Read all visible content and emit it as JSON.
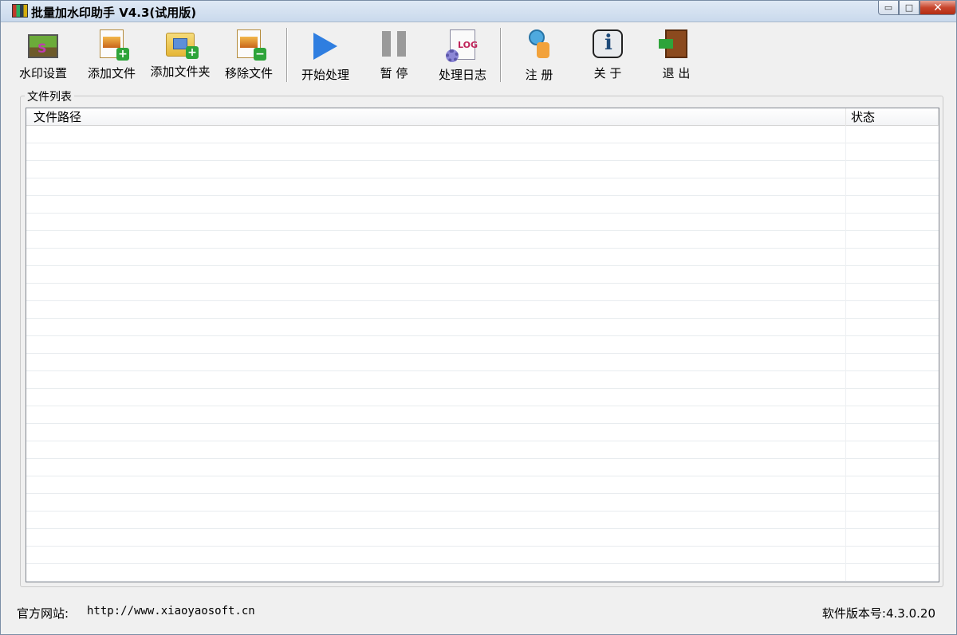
{
  "window": {
    "title": "批量加水印助手 V4.3(试用版)",
    "controls": {
      "minimize": "▭",
      "maximize": "□",
      "close": "✕"
    }
  },
  "toolbar": {
    "buttons": [
      {
        "label": "水印设置",
        "icon": "watermark-settings-icon"
      },
      {
        "label": "添加文件",
        "icon": "add-file-icon"
      },
      {
        "label": "添加文件夹",
        "icon": "add-folder-icon"
      },
      {
        "label": "移除文件",
        "icon": "remove-file-icon"
      },
      {
        "label": "开始处理",
        "icon": "play-icon"
      },
      {
        "label": "暂 停",
        "icon": "pause-icon"
      },
      {
        "label": "处理日志",
        "icon": "log-icon"
      },
      {
        "label": "注 册",
        "icon": "key-user-icon"
      },
      {
        "label": "关 于",
        "icon": "info-icon"
      },
      {
        "label": "退 出",
        "icon": "exit-door-icon"
      }
    ]
  },
  "file_list": {
    "group_title": "文件列表",
    "columns": [
      "文件路径",
      "状态"
    ],
    "rows": []
  },
  "status_bar": {
    "site_label": "官方网站:",
    "site_url": "http://www.xiaoyaosoft.cn",
    "version_label": "软件版本号:4.3.0.20"
  },
  "colors": {
    "titlebar": "#c9d9ec",
    "window_bg": "#f0f0f0",
    "close_button": "#c8462d",
    "play_icon": "#2f7ee0"
  }
}
